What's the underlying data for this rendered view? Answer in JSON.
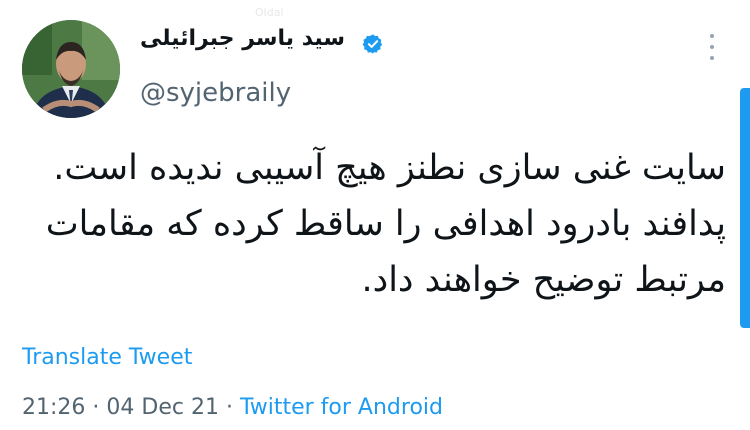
{
  "author": {
    "display_name": "سید یاسر جبرائیلی",
    "handle": "@syjebraily",
    "verified": true,
    "avatar_icon": "profile-photo"
  },
  "tweet": {
    "lines": [
      "سایت غنی سازی نطنز هیچ آسیبی ندیده است.",
      "پدافند بادرود اهدافی را ساقط کرده که مقامات",
      "مرتبط توضیح خواهند داد."
    ]
  },
  "translate_label": "Translate Tweet",
  "meta": {
    "time": "21:26",
    "separator": "·",
    "date": "04 Dec 21",
    "source": "Twitter for Android"
  },
  "colors": {
    "accent": "#1d9bf0",
    "secondary_text": "#536471",
    "primary_text": "#0f1419"
  }
}
